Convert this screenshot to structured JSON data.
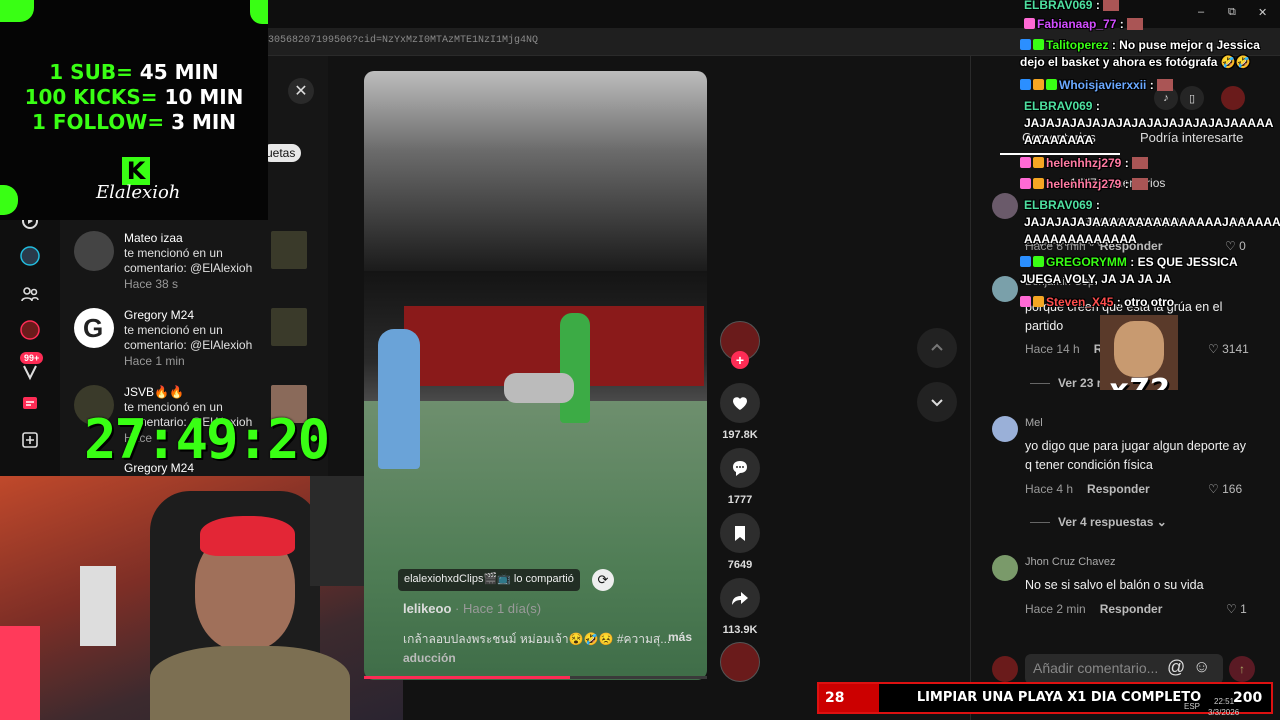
{
  "browser": {
    "url": "30568207199506?cid=NzYxMzI0MTAzMTE1NzI1Mjg4NQ",
    "win_min": "–",
    "win_max": "⧉",
    "win_close": "✕"
  },
  "overlay": {
    "goal_line_1": {
      "label": "1 SUB=",
      "value": "45 MIN"
    },
    "goal_line_2": {
      "label": "100 KICKS=",
      "value": "10 MIN"
    },
    "goal_line_3": {
      "label": "1 FOLLOW=",
      "value": "3 MIN"
    },
    "logo_letter": "K",
    "signature": "Elalexioh",
    "timer": "27:49:20"
  },
  "sidebar": {
    "badge": "99+"
  },
  "notifications": {
    "close_label": "✕",
    "tag_pill": "uetas",
    "items": [
      {
        "name": "Mateo izaa",
        "text": "te mencionó en un comentario: @ElAlexioh",
        "time": "Hace 38 s"
      },
      {
        "name": "Gregory M24",
        "text": "te mencionó en un comentario: @ElAlexioh",
        "time": "Hace 1 min"
      },
      {
        "name": "JSVB🔥🔥",
        "text": "te mencionó en un comentario: @ElAlexioh",
        "time": "Hace"
      },
      {
        "name": "Gregory M24",
        "text": "",
        "time": ""
      }
    ]
  },
  "video": {
    "shared_by": "elalexiohxdClips🎬📺 lo compartió",
    "author": "lelikeoo",
    "posted": "· Hace 1 día(s)",
    "caption": "เกล้าลอบปลงพระชนม์ หม่อมเจ้า😵🤣😣 #ความสุ...",
    "more": "más",
    "translate": "aducción",
    "progress": 0.6
  },
  "actions": {
    "likes": "197.8K",
    "comments": "1777",
    "saves": "7649",
    "shares": "113.9K"
  },
  "comments_panel": {
    "tab_comments": "Comentarios",
    "tab_related": "Podría interesarte",
    "count_label": "1777 comentarios",
    "input_placeholder": "Añadir comentario...",
    "at_icon": "@",
    "comments": [
      {
        "user": "",
        "text": "JAJAJAJAJAAAAAAAAAAAAAAAAAAJAAAAAAAAAAA AAAAAAAAAA",
        "time": "Hace 8 min",
        "reply": "Responder",
        "likes": "0"
      },
      {
        "user": "Benjamin Cop",
        "text": "porque creen que esta la grúa en el partido",
        "time": "Hace 14 h",
        "reply": "Res",
        "likes": "3141",
        "more_replies": "Ver 23 r"
      },
      {
        "user": "Mel",
        "text": "yo digo que para jugar algun deporte ay q tener condición física",
        "time": "Hace 4 h",
        "reply": "Responder",
        "likes": "166",
        "more_replies": "Ver 4 respuestas"
      },
      {
        "user": "Jhon Cruz Chavez",
        "text": "No se si salvo el balón o su vida",
        "time": "Hace 2 min",
        "reply": "Responder",
        "likes": "1"
      }
    ]
  },
  "chat": [
    {
      "user": "ELBRAV069",
      "sep": ":",
      "text": "",
      "color": "#4ee0a0"
    },
    {
      "user": "Fabianaap_77",
      "sep": ":",
      "text": "",
      "color": "#d24dff"
    },
    {
      "user": "Talitoperez",
      "sep": ":",
      "text": "No puse mejor q Jessica dejo el basket y ahora es fotógrafa 🤣🤣",
      "color": "#39ff14"
    },
    {
      "user": "Whoisjavierxxii",
      "sep": ":",
      "text": "",
      "color": "#6aa8ff"
    },
    {
      "user": "ELBRAV069",
      "sep": ":",
      "text": "JAJAJAJAJAJAJAJAJAJAJAJAJAJAAAAAAAAAAAAA",
      "color": "#4ee0a0"
    },
    {
      "user": "helenhhzj279",
      "sep": ":",
      "text": "",
      "color": "#ff7aa2"
    },
    {
      "user": "helenhhzj279",
      "sep": ":",
      "text": "",
      "color": "#ff7aa2"
    },
    {
      "user": "ELBRAV069",
      "sep": ":",
      "text": "JAJAJAJAJAAAAAAAAAAAAAAAJAAAAAAAAAAAAAAAAAAA",
      "color": "#4ee0a0"
    },
    {
      "user": "GREGORYMM",
      "sep": ":",
      "text": "ES QUE JESSICA JUEGA VOLY, JA JA JA JA",
      "color": "#39ff14"
    },
    {
      "user": "Steven_X45",
      "sep": ":",
      "text": "otro otro",
      "color": "#ff4d4d"
    }
  ],
  "meme": {
    "multiplier": "x72"
  },
  "goal_bar": {
    "left_number": "28",
    "title": "LIMPIAR UNA PLAYA X1 DIA COMPLETO",
    "right_number": "200"
  },
  "taskbar": {
    "lang": "ESP",
    "time": "22:51",
    "date": "3/3/2026"
  },
  "colors": {
    "accent": "#fe2c55",
    "overlay_green": "#39ff14",
    "goal_red": "#cc0000"
  }
}
